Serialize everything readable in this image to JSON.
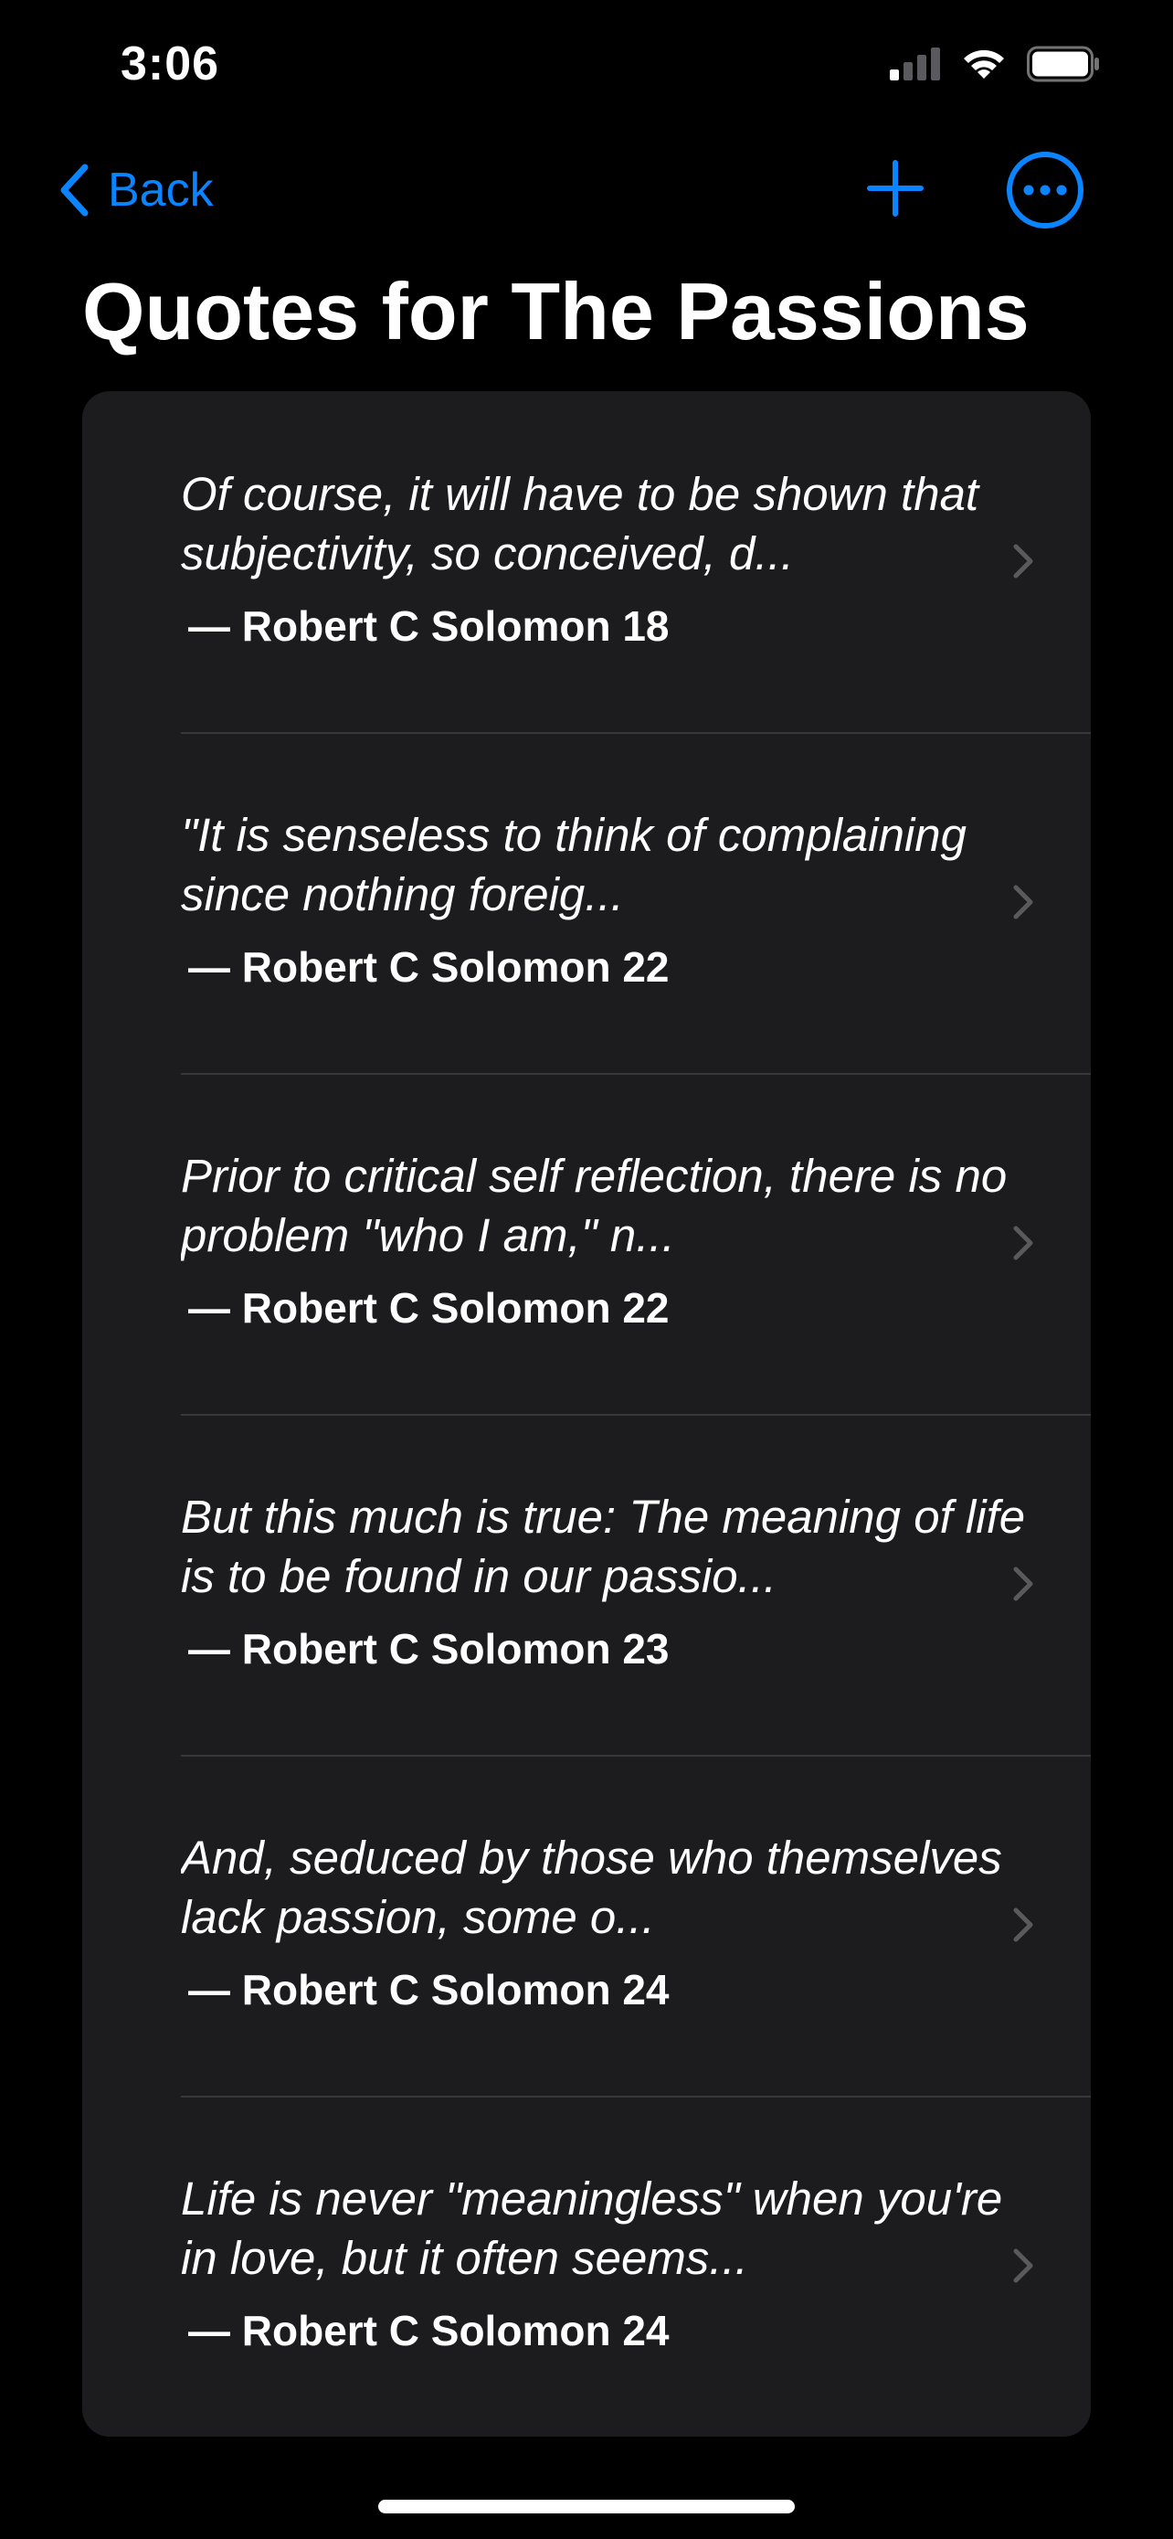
{
  "status_bar": {
    "time": "3:06",
    "icons": [
      "cellular-signal-icon",
      "wifi-icon",
      "battery-icon"
    ]
  },
  "nav": {
    "back_label": "Back",
    "back_icon": "chevron-left-icon",
    "add_icon": "plus-icon",
    "more_icon": "ellipsis-circle-icon"
  },
  "page": {
    "title": "Quotes for The Passions"
  },
  "quotes": [
    {
      "text": "Of course, it will have to be shown that subjectivity, so conceived, d...",
      "source": "— Robert C Solomon 18"
    },
    {
      "text": "\"It is senseless to think of complaining since nothing foreig...",
      "source": "— Robert C Solomon 22"
    },
    {
      "text": "Prior to critical self reflection, there is no problem \"who I am,\" n...",
      "source": "— Robert C Solomon 22"
    },
    {
      "text": "But this much is true: The meaning of life is to be found in our passio...",
      "source": "— Robert C Solomon 23"
    },
    {
      "text": "And, seduced by those who themselves lack passion, some o...",
      "source": "— Robert C Solomon 24"
    },
    {
      "text": "Life is never \"meaningless\" when you're in love, but it often seems...",
      "source": "— Robert C Solomon 24"
    }
  ],
  "colors": {
    "accent": "#0a84ff",
    "background": "#000000",
    "card": "#1c1c1e",
    "separator": "#38383a",
    "chevron": "#5a5a5e"
  }
}
